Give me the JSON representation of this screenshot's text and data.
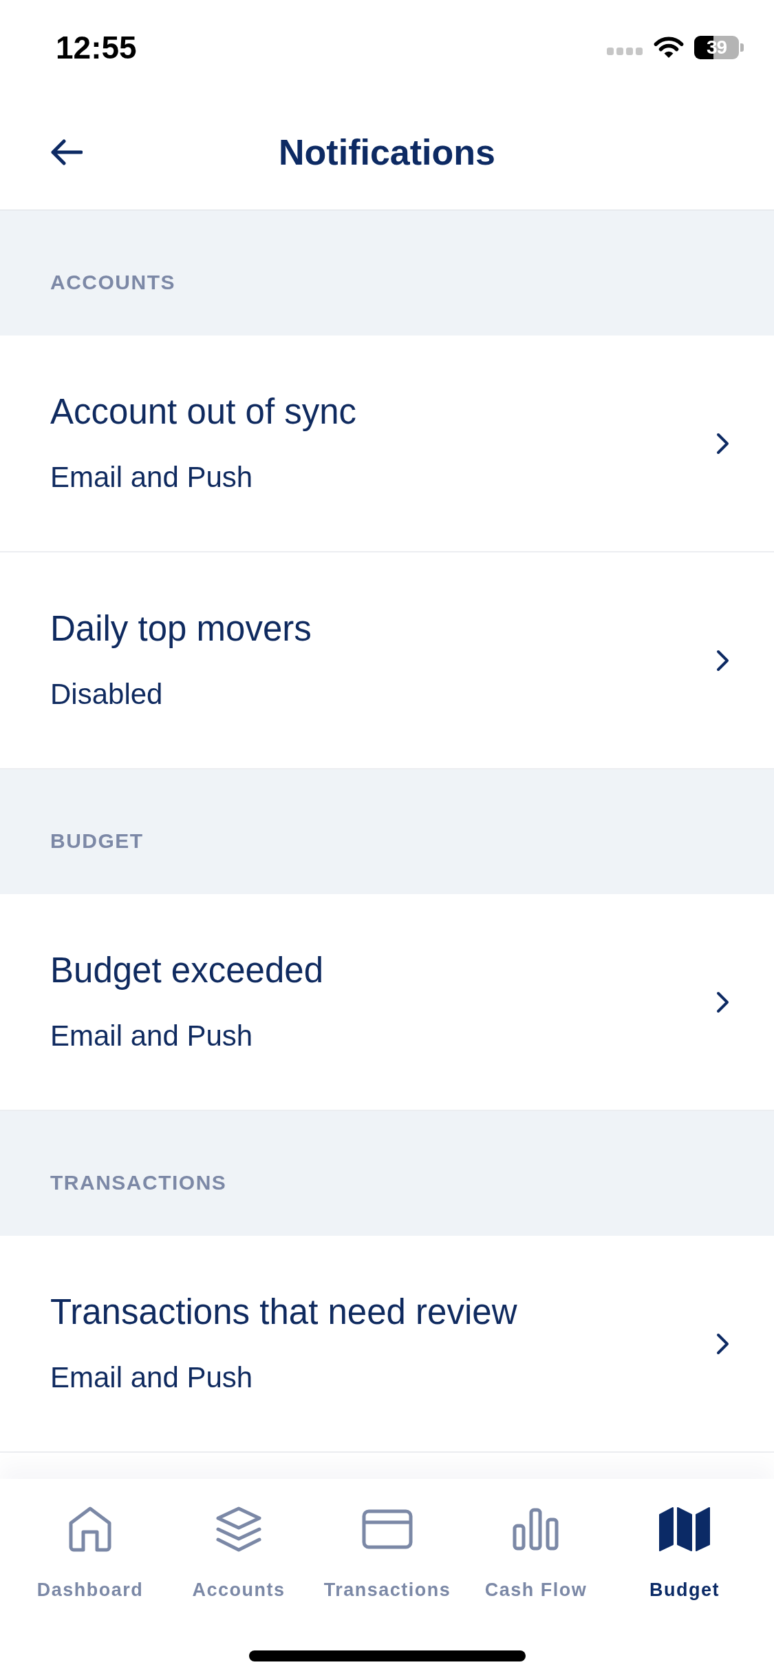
{
  "status_bar": {
    "time": "12:55",
    "battery": "39"
  },
  "header": {
    "title": "Notifications"
  },
  "sections": [
    {
      "heading": "ACCOUNTS",
      "items": [
        {
          "title": "Account out of sync",
          "status": "Email and Push"
        },
        {
          "title": "Daily top movers",
          "status": "Disabled"
        }
      ]
    },
    {
      "heading": "BUDGET",
      "items": [
        {
          "title": "Budget exceeded",
          "status": "Email and Push"
        }
      ]
    },
    {
      "heading": "TRANSACTIONS",
      "items": [
        {
          "title": "Transactions that need review",
          "status": "Email and Push"
        }
      ]
    }
  ],
  "tab_bar": {
    "items": [
      {
        "label": "Dashboard",
        "kind": "home",
        "selected": false
      },
      {
        "label": "Accounts",
        "kind": "layers",
        "selected": false
      },
      {
        "label": "Transactions",
        "kind": "card",
        "selected": false
      },
      {
        "label": "Cash Flow",
        "kind": "bars",
        "selected": false
      },
      {
        "label": "Budget",
        "kind": "map",
        "selected": true
      }
    ]
  }
}
